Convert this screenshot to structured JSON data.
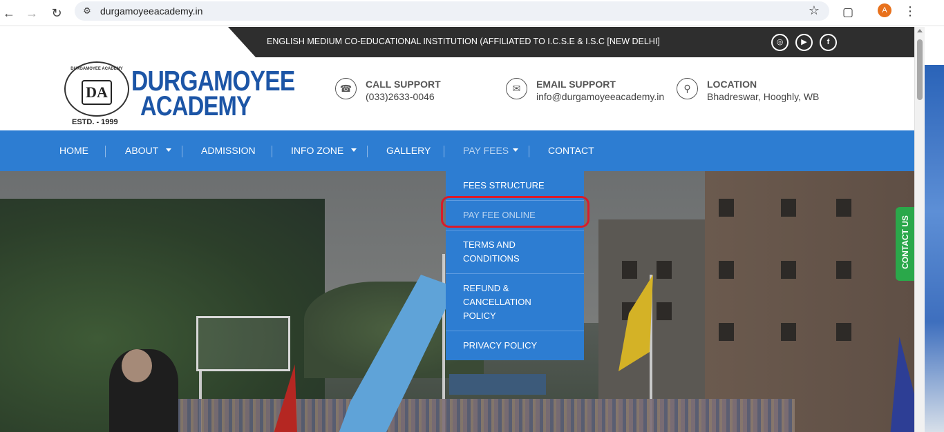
{
  "browser": {
    "url": "durgamoyeeacademy.in",
    "avatar_letter": "A",
    "icons": [
      "back-arrow-icon",
      "forward-arrow-icon",
      "reload-icon",
      "site-info-icon",
      "bookmark-star-icon",
      "extensions-icon",
      "menu-kebab-icon"
    ]
  },
  "topbar": {
    "tagline": "ENGLISH MEDIUM CO-EDUCATIONAL INSTITUTION (AFFILIATED TO I.C.S.E & I.S.C [NEW DELHI]",
    "social": [
      "instagram-icon",
      "youtube-icon",
      "facebook-icon"
    ]
  },
  "header": {
    "logo_ring_text": "DURGAMOYEE ACADEMY",
    "logo_monogram": "DA",
    "estd": "ESTD. - 1999",
    "brand_line1": "DURGAMOYEE",
    "brand_line2": "ACADEMY",
    "call": {
      "title": "CALL SUPPORT",
      "value": "(033)2633-0046",
      "icon": "phone-icon"
    },
    "email": {
      "title": "EMAIL SUPPORT",
      "value": "info@durgamoyeeacademy.in",
      "icon": "envelope-icon"
    },
    "location": {
      "title": "LOCATION",
      "value": "Bhadreswar, Hooghly, WB",
      "icon": "map-pin-icon"
    }
  },
  "nav": {
    "items": [
      {
        "label": "HOME"
      },
      {
        "label": "ABOUT",
        "has_dropdown": true
      },
      {
        "label": "ADMISSION"
      },
      {
        "label": "INFO ZONE",
        "has_dropdown": true
      },
      {
        "label": "GALLERY"
      },
      {
        "label": "PAY FEES",
        "has_dropdown": true,
        "active": true
      },
      {
        "label": "CONTACT"
      }
    ]
  },
  "dropdown": {
    "items": [
      {
        "label": "FEES STRUCTURE"
      },
      {
        "label": "PAY FEE ONLINE",
        "highlighted": true
      },
      {
        "label": "TERMS AND CONDITIONS"
      },
      {
        "label": "REFUND & CANCELLATION POLICY"
      },
      {
        "label": "PRIVACY POLICY"
      }
    ]
  },
  "contact_tab": {
    "label": "CONTACT US"
  },
  "colors": {
    "nav_blue": "#2d7dd2",
    "topbar_dark": "#2e2e2e",
    "brand_blue": "#1c55a6",
    "highlight_red": "#d91b2a",
    "contact_green": "#2aa84a"
  }
}
